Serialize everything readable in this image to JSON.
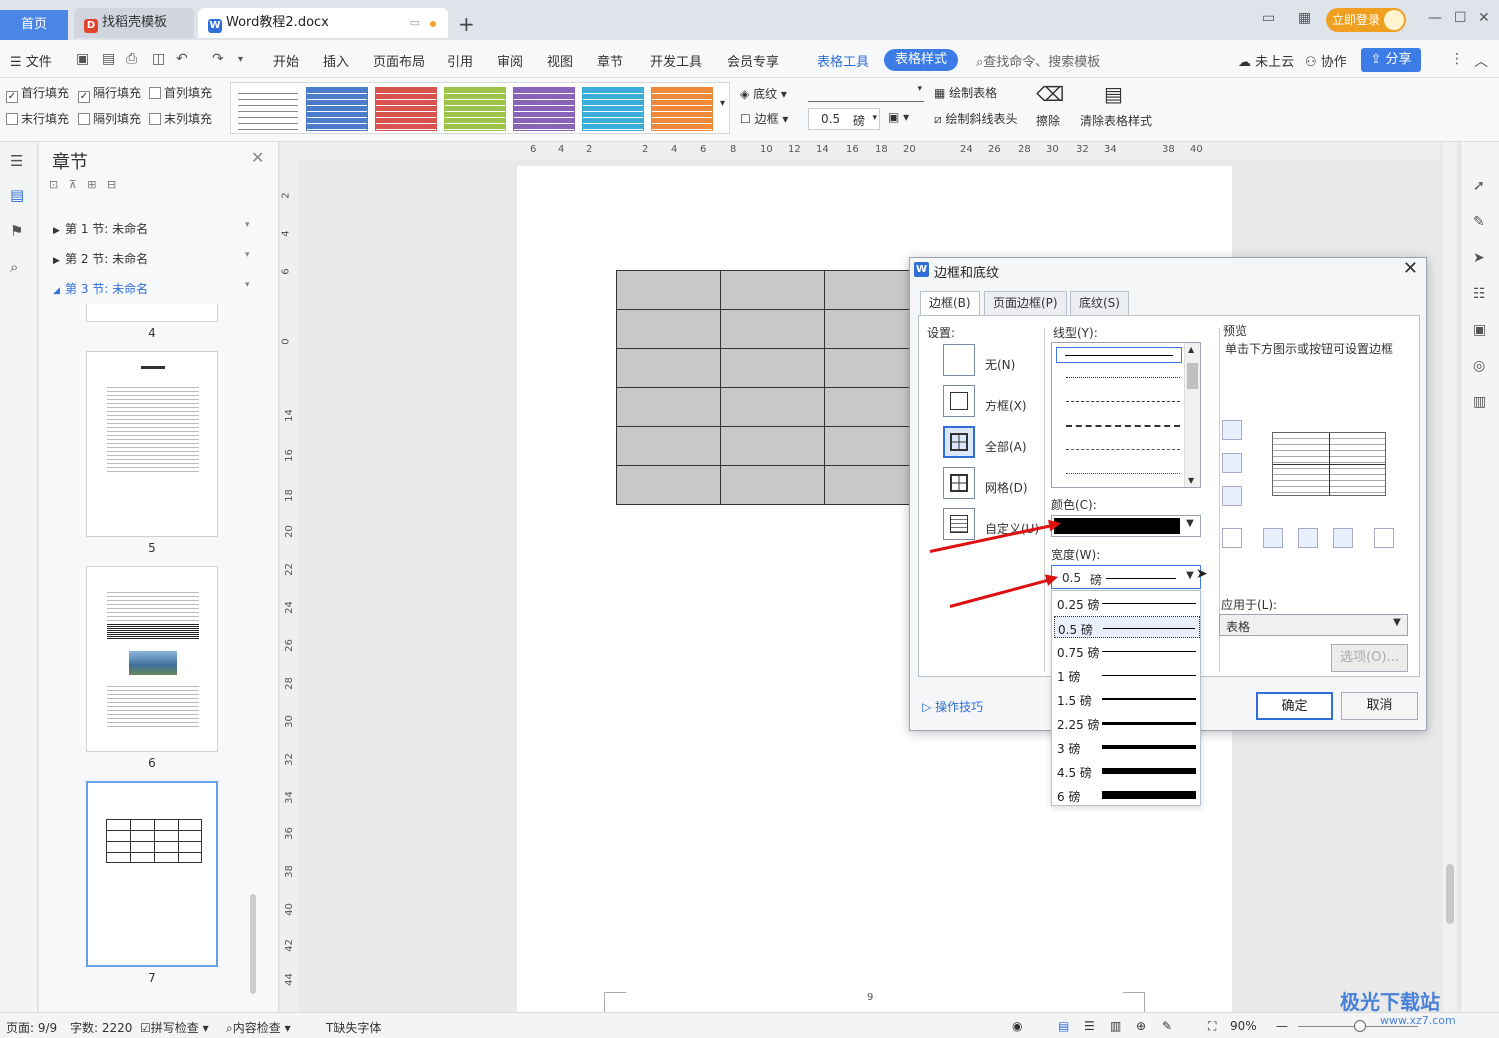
{
  "tabs": {
    "home": "首页",
    "template": "找稻壳模板",
    "doc": "Word教程2.docx"
  },
  "login": "立即登录",
  "menu": {
    "file": "文件",
    "items": [
      "开始",
      "插入",
      "页面布局",
      "引用",
      "审阅",
      "视图",
      "章节",
      "开发工具",
      "会员专享"
    ],
    "table_tools": "表格工具",
    "table_style": "表格样式",
    "search": "查找命令、搜索模板",
    "cloud": "未上云",
    "collab": "协作",
    "share": "分享"
  },
  "ribbon": {
    "checks": [
      {
        "label": "首行填充",
        "checked": true
      },
      {
        "label": "隔行填充",
        "checked": true
      },
      {
        "label": "首列填充",
        "checked": false
      },
      {
        "label": "末行填充",
        "checked": false
      },
      {
        "label": "隔列填充",
        "checked": false
      },
      {
        "label": "末列填充",
        "checked": false
      }
    ],
    "style_colors": [
      "#888888",
      "#4a7cc9",
      "#d9534f",
      "#9cc34a",
      "#8a63b8",
      "#3aaed8",
      "#f0883a"
    ],
    "shading": "底纹",
    "border": "边框",
    "width_value": "0.5",
    "width_unit": "磅",
    "draw_table": "绘制表格",
    "draw_diag": "绘制斜线表头",
    "erase": "擦除",
    "clear_style": "清除表格样式"
  },
  "chapter": {
    "title": "章节",
    "sections": [
      "第 1 节: 未命名",
      "第 2 节: 未命名",
      "第 3 节: 未命名"
    ],
    "pages": [
      "4",
      "5",
      "6",
      "7"
    ]
  },
  "ruler": {
    "h": [
      "6",
      "4",
      "2",
      "2",
      "4",
      "6",
      "8",
      "10",
      "12",
      "14",
      "16",
      "18",
      "20",
      "24",
      "26",
      "28",
      "30",
      "32",
      "34",
      "38",
      "40"
    ],
    "v": [
      "2",
      "4",
      "6",
      "0",
      "14",
      "16",
      "18",
      "20",
      "22",
      "24",
      "26",
      "28",
      "30",
      "32",
      "34",
      "36",
      "38",
      "40",
      "42",
      "44"
    ]
  },
  "page_footer": "9",
  "dialog": {
    "title": "边框和底纹",
    "tabs": [
      "边框(B)",
      "页面边框(P)",
      "底纹(S)"
    ],
    "settings_label": "设置:",
    "settings": [
      "无(N)",
      "方框(X)",
      "全部(A)",
      "网格(D)",
      "自定义(U)"
    ],
    "line_style_label": "线型(Y):",
    "color_label": "颜色(C):",
    "width_label": "宽度(W):",
    "width_value": "0.5",
    "width_unit": "磅",
    "preview_label": "预览",
    "preview_hint": "单击下方图示或按钮可设置边框",
    "apply_label": "应用于(L):",
    "apply_value": "表格",
    "options": "选项(O)...",
    "tips": "操作技巧",
    "ok": "确定",
    "cancel": "取消"
  },
  "width_options": [
    {
      "value": "0.25",
      "unit": "磅",
      "thickness": 0.25
    },
    {
      "value": "0.5",
      "unit": "磅",
      "thickness": 0.5,
      "selected": true
    },
    {
      "value": "0.75",
      "unit": "磅",
      "thickness": 0.75
    },
    {
      "value": "1",
      "unit": "磅",
      "thickness": 1
    },
    {
      "value": "1.5",
      "unit": "磅",
      "thickness": 1.5
    },
    {
      "value": "2.25",
      "unit": "磅",
      "thickness": 2.25
    },
    {
      "value": "3",
      "unit": "磅",
      "thickness": 3
    },
    {
      "value": "4.5",
      "unit": "磅",
      "thickness": 4.5
    },
    {
      "value": "6",
      "unit": "磅",
      "thickness": 6
    }
  ],
  "status": {
    "page": "页面: 9/9",
    "words": "字数: 2220",
    "spell": "拼写检查",
    "content": "内容检查",
    "font": "缺失字体",
    "zoom": "90%"
  },
  "watermark": {
    "main": "极光下载站",
    "url": "www.xz7.com"
  }
}
